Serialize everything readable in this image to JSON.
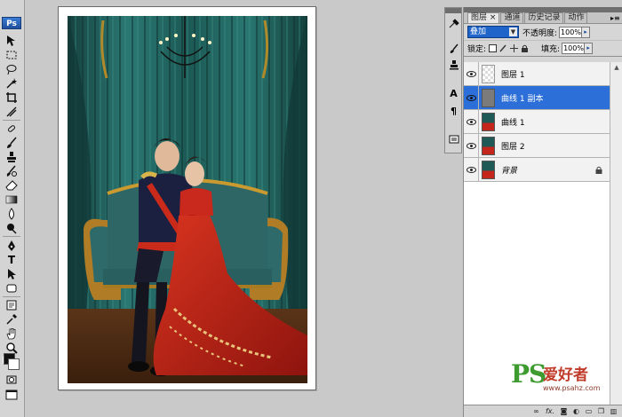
{
  "app": {
    "logo": "Ps"
  },
  "layers_panel": {
    "tabs": [
      {
        "label": "图层",
        "close": "×"
      },
      {
        "label": "通道"
      },
      {
        "label": "历史记录"
      },
      {
        "label": "动作"
      }
    ],
    "blend_mode": "叠加",
    "opacity_label": "不透明度:",
    "opacity_value": "100%",
    "lock_label": "锁定:",
    "fill_label": "填充:",
    "fill_value": "100%",
    "layers": [
      {
        "name": "图层 1",
        "thumb": "transparent",
        "selected": false
      },
      {
        "name": "曲线 1 副本",
        "thumb": "gray",
        "selected": true
      },
      {
        "name": "曲线 1",
        "thumb": "photo",
        "selected": false
      },
      {
        "name": "图层 2",
        "thumb": "photo",
        "selected": false
      },
      {
        "name": "背景",
        "thumb": "photo",
        "selected": false,
        "locked": true
      }
    ],
    "bottom_icons": [
      "link-icon",
      "fx-icon",
      "mask-icon",
      "adjustment-icon",
      "group-icon",
      "new-layer-icon",
      "trash-icon"
    ],
    "fx_label": "fx."
  },
  "watermark": {
    "logo": "PS",
    "text": "爱好者",
    "url": "www.psahz.com"
  },
  "colors": {
    "selection": "#2d6fd8",
    "curtain": "#1f5f5c",
    "dress": "#c5261c"
  }
}
